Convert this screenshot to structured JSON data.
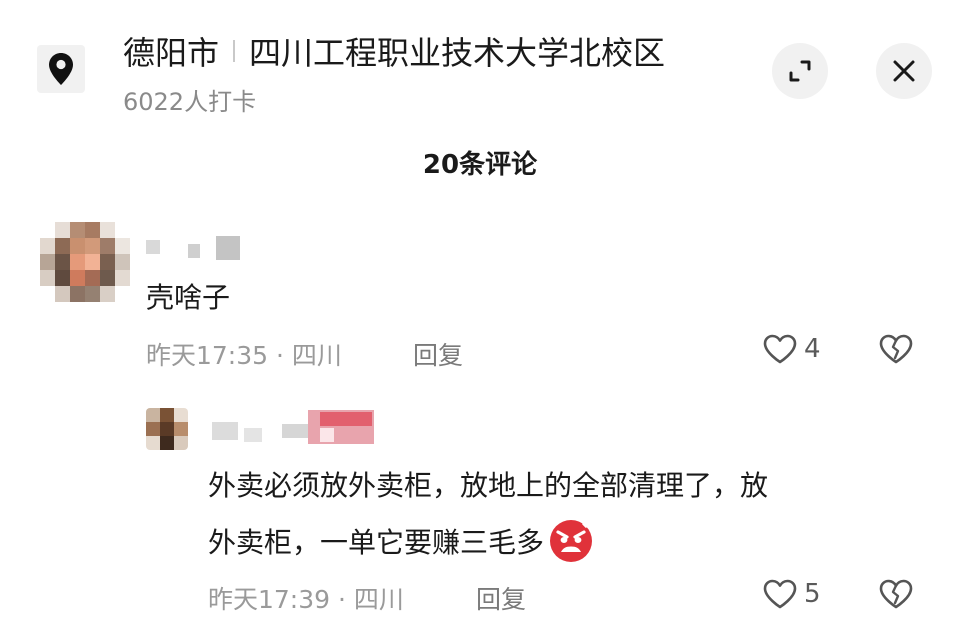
{
  "location": {
    "city": "德阳市",
    "place": "四川工程职业技术大学北校区",
    "checkins": "6022人打卡"
  },
  "header": {
    "expand_icon": "expand-icon",
    "close_icon": "close-icon",
    "comment_count": "20条评论"
  },
  "comments": [
    {
      "text": "壳啥子",
      "meta": "昨天17:35 · 四川",
      "reply_label": "回复",
      "likes": "4"
    },
    {
      "text_line1": "外卖必须放外卖柜，放地上的全部清理了，放",
      "text_line2": "外卖柜，一单它要赚三毛多",
      "emoji": "angry-face-emoji",
      "meta": "昨天17:39 · 四川",
      "reply_label": "回复",
      "likes": "5"
    }
  ],
  "colors": {
    "text": "#1a1a1a",
    "muted": "#9a9a9a",
    "button_bg": "#f1f1f1",
    "emoji_red": "#e0323a"
  }
}
